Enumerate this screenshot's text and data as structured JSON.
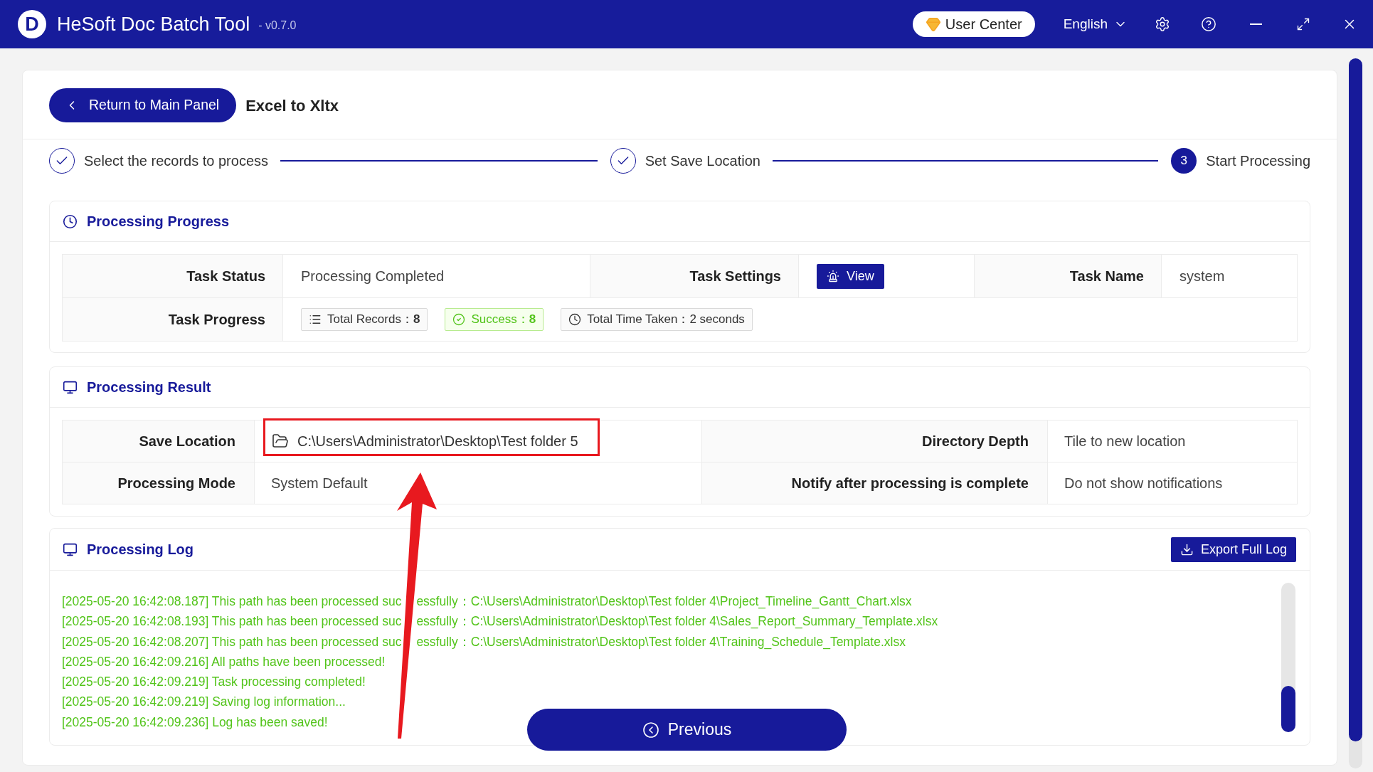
{
  "window": {
    "logo": "D",
    "title": "HeSoft Doc Batch Tool",
    "version": "- v0.7.0",
    "user_center": "User Center",
    "language": "English"
  },
  "header": {
    "back_button": "Return to Main Panel",
    "title": "Excel to Xltx"
  },
  "steps": [
    {
      "label": "Select the records to process",
      "completed": true
    },
    {
      "label": "Set Save Location",
      "completed": true
    },
    {
      "label": "Start Processing",
      "completed": false,
      "number": "3"
    }
  ],
  "progress": {
    "title": "Processing Progress",
    "status_label": "Task Status",
    "status": "Processing Completed",
    "settings_label": "Task Settings",
    "view_button": "View",
    "name_label": "Task Name",
    "name": "system",
    "progress_label": "Task Progress",
    "tags": [
      {
        "kind": "total",
        "text": "Total Records：**8**"
      },
      {
        "kind": "success",
        "text": "Success：**8**"
      },
      {
        "kind": "time",
        "text": "Total Time Taken：2 seconds"
      }
    ]
  },
  "result": {
    "title": "Processing Result",
    "fields": [
      {
        "label": "Save Location",
        "value": "C:\\Users\\Administrator\\Desktop\\Test folder 5",
        "kind": "folder"
      },
      {
        "label": "Directory Depth",
        "value": "Tile to new location",
        "kind": "text"
      },
      {
        "label": "Processing Mode",
        "value": "System Default",
        "kind": "text"
      },
      {
        "label": "Notify after processing is complete",
        "value": "Do not show notifications",
        "kind": "text"
      }
    ]
  },
  "log": {
    "title": "Processing Log",
    "export_button": "Export Full Log",
    "lines": [
      {
        "parts": [
          "[2025-05-20 16:42:08.187] This path has been processed suc",
          "essfully：C:\\Users\\Administrator\\Desktop\\Test folder 4\\Project_Timeline_Gantt_Chart.xlsx"
        ]
      },
      {
        "parts": [
          "[2025-05-20 16:42:08.193] This path has been processed suc",
          "essfully：C:\\Users\\Administrator\\Desktop\\Test folder 4\\Sales_Report_Summary_Template.xlsx"
        ]
      },
      {
        "parts": [
          "[2025-05-20 16:42:08.207] This path has been processed suc",
          "essfully：C:\\Users\\Administrator\\Desktop\\Test folder 4\\Training_Schedule_Template.xlsx"
        ]
      },
      {
        "parts": [
          "[2025-05-20 16:42:09.216] All paths have been processed!"
        ]
      },
      {
        "parts": [
          "[2025-05-20 16:42:09.219] Task processing completed!"
        ]
      },
      {
        "parts": [
          "[2025-05-20 16:42:09.219] Saving log information..."
        ]
      },
      {
        "parts": [
          "[2025-05-20 16:42:09.236] Log has been saved!"
        ]
      }
    ]
  },
  "previous_button": "Previous"
}
